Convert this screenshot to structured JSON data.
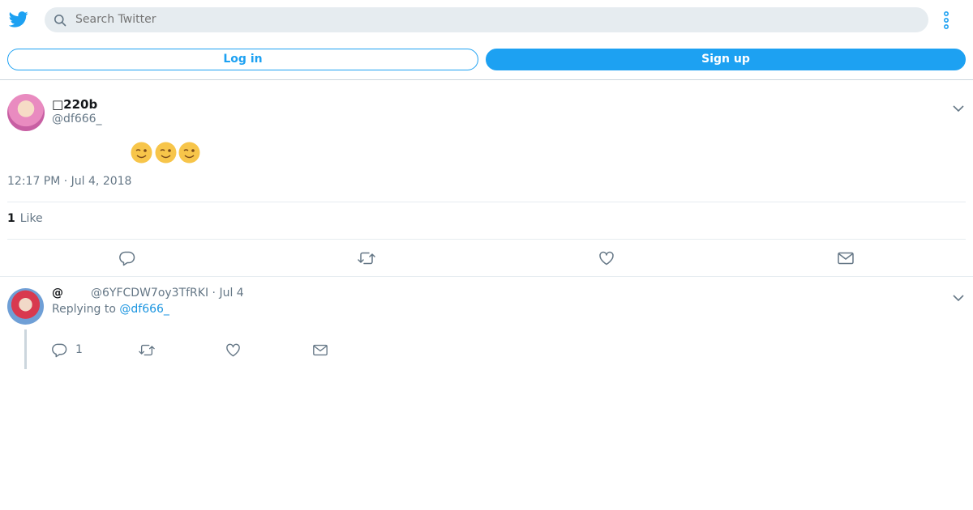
{
  "search": {
    "placeholder": "Search Twitter"
  },
  "auth": {
    "login_label": "Log in",
    "signup_label": "Sign up"
  },
  "tweet": {
    "name": "□220b",
    "handle": "@df666_",
    "emoji_icons": [
      "winking-face-emoji",
      "winking-face-emoji",
      "winking-face-emoji"
    ],
    "timestamp": "12:17 PM · Jul 4, 2018",
    "like_count": "1",
    "like_label": "Like"
  },
  "reply": {
    "name": "@",
    "meta": "@6YFCDW7oy3TfRKI · Jul 4",
    "replying_prefix": "Replying to",
    "replying_handle": "@df666_",
    "reply_count": "1"
  },
  "colors": {
    "accent": "#1da1f2",
    "muted": "#657786",
    "separator": "#e6ecf0"
  }
}
